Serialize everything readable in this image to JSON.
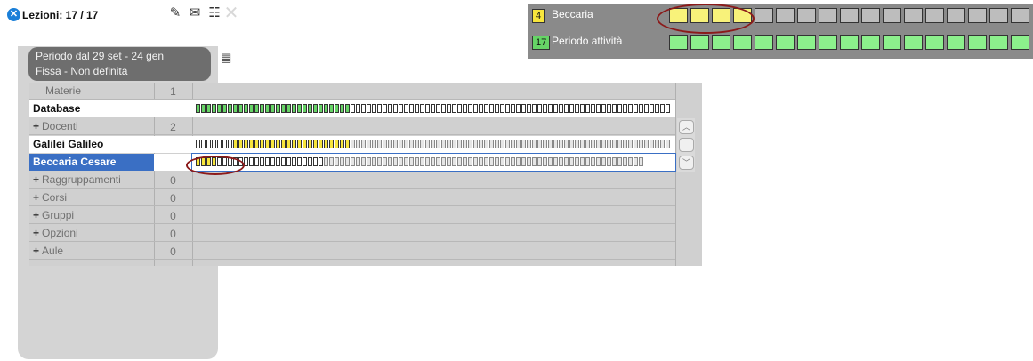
{
  "header": {
    "title": "Lezioni: 17 / 17",
    "period_line1": "Periodo dal 29 set - 24 gen",
    "period_line2": "Fissa - Non definita",
    "close_icon": "close-circle-icon",
    "icons": [
      "edit-book-icon",
      "envelope-icon",
      "calendar-t-icon",
      "close-x-icon",
      "calendar-icon"
    ]
  },
  "grid": {
    "rows": [
      {
        "label": "Materie",
        "count": "1",
        "kind": "gray"
      },
      {
        "label": "Database",
        "count": "",
        "kind": "white"
      },
      {
        "label": "Docenti",
        "count": "2",
        "kind": "gray",
        "expander": "+"
      },
      {
        "label": "Galilei Galileo",
        "count": "",
        "kind": "white"
      },
      {
        "label": "Beccaria Cesare",
        "count": "",
        "kind": "selected"
      },
      {
        "label": "Raggruppamenti",
        "count": "0",
        "kind": "gray",
        "expander": "+"
      },
      {
        "label": "Corsi",
        "count": "0",
        "kind": "gray",
        "expander": "+"
      },
      {
        "label": "Gruppi",
        "count": "0",
        "kind": "gray",
        "expander": "+"
      },
      {
        "label": "Opzioni",
        "count": "0",
        "kind": "gray",
        "expander": "+"
      },
      {
        "label": "Aule",
        "count": "0",
        "kind": "gray",
        "expander": "+"
      }
    ],
    "database_bar": {
      "green": 29,
      "empty": 60
    },
    "galilei_bar": {
      "empty": 7,
      "yellow": 22,
      "gray": 60
    },
    "beccaria_bar": {
      "yellow": 4,
      "empty": 20,
      "gray": 60
    }
  },
  "legend": {
    "rows": [
      {
        "badge": "4",
        "name": "Beccaria",
        "color": "#f8e63c",
        "filled": 4,
        "total": 17
      },
      {
        "badge": "17",
        "name": "Periodo attività",
        "color": "#66d466",
        "filled": 17,
        "total": 17
      }
    ]
  },
  "colors": {
    "highlight": "#8b1a1a",
    "selected": "#3a6fc4",
    "green": "#66d466",
    "yellow": "#f8e63c"
  }
}
